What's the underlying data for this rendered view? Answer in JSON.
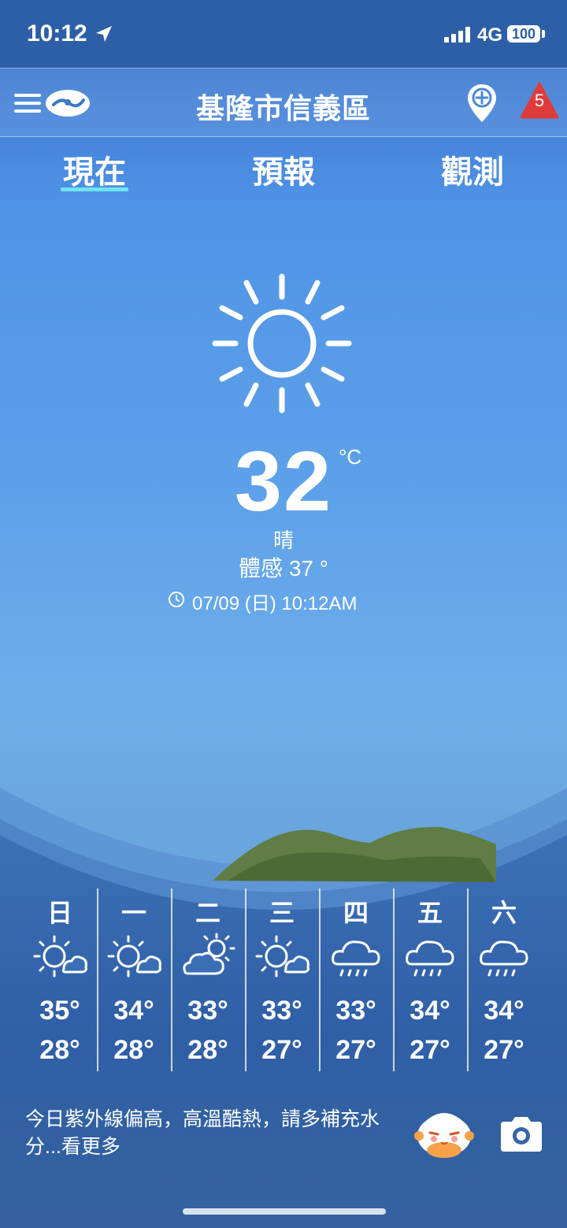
{
  "status_bar": {
    "time": "10:12",
    "network": "4G",
    "battery": "100"
  },
  "header": {
    "city": "基隆市信義區",
    "alert_count": "5"
  },
  "tabs": [
    {
      "label": "現在",
      "active": true
    },
    {
      "label": "預報",
      "active": false
    },
    {
      "label": "觀測",
      "active": false
    }
  ],
  "current": {
    "icon": "sun-icon",
    "temperature": "32",
    "unit": "°C",
    "condition": "晴",
    "feels_like": "體感 37 °",
    "updated": "07/09 (日) 10:12AM"
  },
  "week": [
    {
      "day": "日",
      "icon": "sun-cloud-icon",
      "high": "35°",
      "low": "28°"
    },
    {
      "day": "一",
      "icon": "sun-cloud-icon",
      "high": "34°",
      "low": "28°"
    },
    {
      "day": "二",
      "icon": "cloud-sun-icon",
      "high": "33°",
      "low": "28°"
    },
    {
      "day": "三",
      "icon": "sun-cloud-icon",
      "high": "33°",
      "low": "27°"
    },
    {
      "day": "四",
      "icon": "cloud-rain-icon",
      "high": "33°",
      "low": "27°"
    },
    {
      "day": "五",
      "icon": "cloud-rain-icon",
      "high": "34°",
      "low": "27°"
    },
    {
      "day": "六",
      "icon": "cloud-rain-icon",
      "high": "34°",
      "low": "27°"
    }
  ],
  "tip": {
    "text": "今日紫外線偏高，高溫酷熱，請多補充水分...看更多"
  },
  "colors": {
    "accent_underline": "#6ee3f0",
    "alert_red": "#e03b3b"
  }
}
